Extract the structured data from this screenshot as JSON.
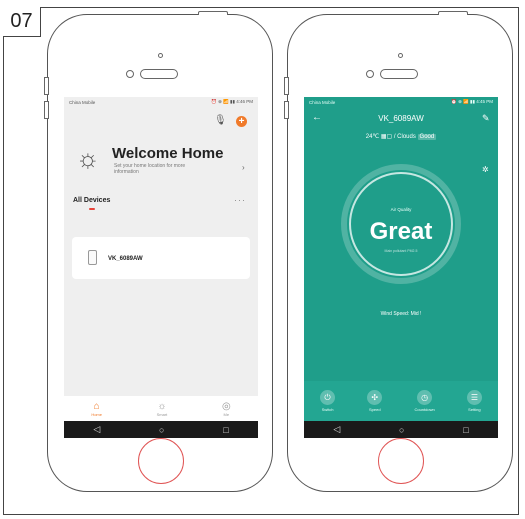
{
  "step_number": "07",
  "left_screen": {
    "status_left": "China Mobile",
    "status_right": "⏰ ⊕ 📶 ▮▮ 4:46 PM",
    "add_symbol": "+",
    "mic_symbol": "🎙",
    "welcome_title": "Welcome Home",
    "welcome_sub": "Set your home location for more information",
    "section_title": "All Devices",
    "more_dots": "···",
    "chevron": "›",
    "device_name": "VK_6089AW",
    "tabs": [
      {
        "label": "Home",
        "icon": "home-icon"
      },
      {
        "label": "Smart",
        "icon": "smart-icon"
      },
      {
        "label": "Me",
        "icon": "me-icon"
      }
    ],
    "accent_color": "#f07a2a"
  },
  "right_screen": {
    "status_left": "China Mobile",
    "status_right": "⏰ ⊕ 📶 ▮▮ 4:45 PM",
    "back_symbol": "←",
    "edit_symbol": "✎",
    "title": "VK_6089AW",
    "weather": "24℃  ▦▢ / Clouds",
    "weather_badge": "Good",
    "aq_label": "Air Quality",
    "aq_value": "Great",
    "aq_sub": "Main pollutant PM2.5",
    "wind_speed": "Wind Speed: Mid !",
    "controls": [
      {
        "label": "Switch",
        "symbol": "⏻"
      },
      {
        "label": "Speed",
        "symbol": "✣"
      },
      {
        "label": "Countdown",
        "symbol": "◷"
      },
      {
        "label": "Setting",
        "symbol": "☰"
      }
    ],
    "bg_color": "#1f9e8a"
  },
  "nav_symbols": {
    "back": "◁",
    "home": "○",
    "recent": "□"
  }
}
